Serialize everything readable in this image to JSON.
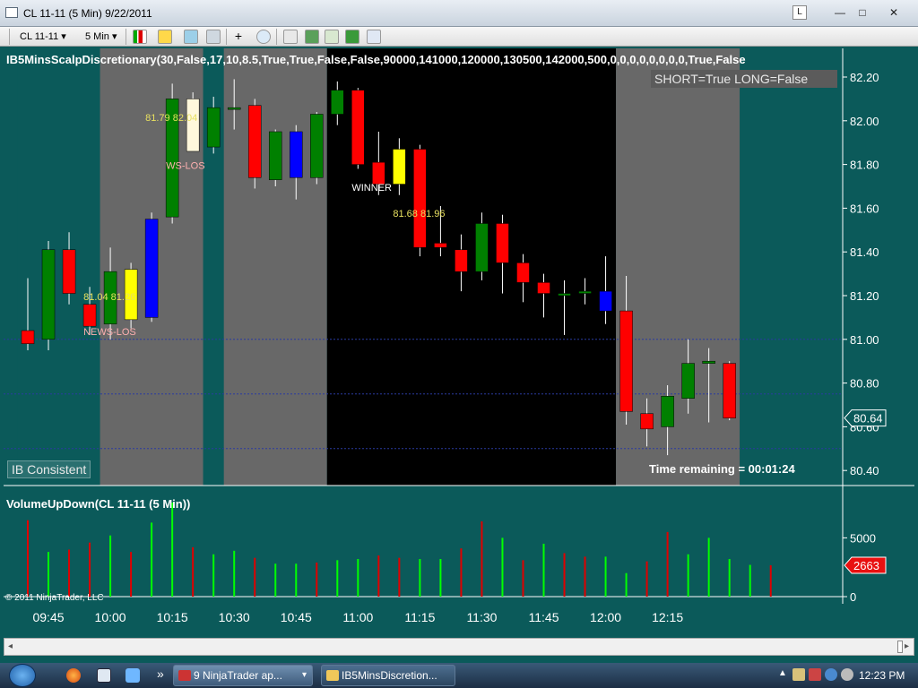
{
  "window": {
    "title": "CL 11-11 (5 Min)  9/22/2011",
    "link_label": "L",
    "minimize": "—",
    "maximize": "□",
    "close": "✕"
  },
  "toolbar": {
    "instrument": "CL 11-11",
    "interval": "5 Min",
    "dropdown_glyph": "▾"
  },
  "colors": {
    "background": "#0b5a5a",
    "up_candle": "#008000",
    "down_candle": "#ff0000",
    "highlight_yellow": "#ffff00",
    "highlight_blue": "#0000ff",
    "highlight_cream": "#fff8dc",
    "session_gray": "#686868",
    "session_black": "#000000",
    "volume_up": "#00ff00",
    "volume_down": "#e00000"
  },
  "chart_data": [
    {
      "type": "candlestick",
      "title": "IB5MinsScalpDiscretionary(30,False,17,10,8.5,True,True,False,False,90000,141000,120000,130500,142000,500,0,0,0,0,0,0,0,0,True,False",
      "y_ticks": [
        "82.20",
        "82.00",
        "81.80",
        "81.60",
        "81.40",
        "81.20",
        "81.00",
        "80.80",
        "80.60",
        "80.40"
      ],
      "ylim": [
        80.36,
        82.27
      ],
      "x_ticks": [
        "09:45",
        "10:00",
        "10:15",
        "10:30",
        "10:45",
        "11:00",
        "11:15",
        "11:30",
        "11:45",
        "12:00",
        "12:15"
      ],
      "last_price": "80.64",
      "status_text": "SHORT=True LONG=False",
      "time_remaining": "Time remaining = 00:01:24",
      "corner_label": "IB Consistent",
      "horizontal_lines": [
        81.0,
        80.75,
        80.5
      ],
      "trade_labels": [
        {
          "text": "81.04  81.26",
          "bar": 4,
          "price": 81.18
        },
        {
          "text": "NEWS-LOS",
          "bar": 4,
          "price": 81.02
        },
        {
          "text": "81.79  82.04",
          "bar": 7,
          "price": 82.0
        },
        {
          "text": "WS-LOS",
          "bar": 8,
          "price": 81.78
        },
        {
          "text": "WINNER",
          "bar": 17,
          "price": 81.68
        },
        {
          "text": "81.68  81.96",
          "bar": 19,
          "price": 81.56
        }
      ],
      "sessions": [
        {
          "from": -0.5,
          "to": 3.5,
          "color": "bg"
        },
        {
          "from": 3.5,
          "to": 8.5,
          "color": "gray"
        },
        {
          "from": 8.5,
          "to": 9.5,
          "color": "bg"
        },
        {
          "from": 9.5,
          "to": 14.5,
          "color": "gray"
        },
        {
          "from": 14.5,
          "to": 28.5,
          "color": "black"
        },
        {
          "from": 28.5,
          "to": 34.5,
          "color": "gray"
        },
        {
          "from": 34.5,
          "to": 39.5,
          "color": "bg"
        }
      ],
      "bars": [
        {
          "t": "09:40",
          "o": 81.04,
          "h": 81.28,
          "l": 80.95,
          "c": 80.98,
          "color": "red"
        },
        {
          "t": "09:45",
          "o": 81.0,
          "h": 81.45,
          "l": 80.95,
          "c": 81.41,
          "color": "green"
        },
        {
          "t": "09:50",
          "o": 81.41,
          "h": 81.49,
          "l": 81.16,
          "c": 81.21,
          "color": "red"
        },
        {
          "t": "09:55",
          "o": 81.16,
          "h": 81.24,
          "l": 81.02,
          "c": 81.06,
          "color": "red"
        },
        {
          "t": "10:00",
          "o": 81.07,
          "h": 81.42,
          "l": 81.0,
          "c": 81.31,
          "color": "green"
        },
        {
          "t": "10:05",
          "o": 81.32,
          "h": 81.35,
          "l": 81.05,
          "c": 81.09,
          "color": "yellow"
        },
        {
          "t": "10:10",
          "o": 81.1,
          "h": 81.58,
          "l": 81.08,
          "c": 81.55,
          "color": "blue"
        },
        {
          "t": "10:15",
          "o": 81.56,
          "h": 82.17,
          "l": 81.53,
          "c": 82.1,
          "color": "green"
        },
        {
          "t": "10:20",
          "o": 82.1,
          "h": 82.13,
          "l": 81.87,
          "c": 81.86,
          "color": "cream"
        },
        {
          "t": "10:25",
          "o": 81.88,
          "h": 82.11,
          "l": 81.85,
          "c": 82.06,
          "color": "green"
        },
        {
          "t": "10:30",
          "o": 82.06,
          "h": 82.19,
          "l": 81.96,
          "c": 82.06,
          "color": "green"
        },
        {
          "t": "10:35",
          "o": 82.07,
          "h": 82.1,
          "l": 81.69,
          "c": 81.74,
          "color": "red"
        },
        {
          "t": "10:40",
          "o": 81.73,
          "h": 81.96,
          "l": 81.7,
          "c": 81.95,
          "color": "green"
        },
        {
          "t": "10:45",
          "o": 81.95,
          "h": 81.98,
          "l": 81.64,
          "c": 81.74,
          "color": "blue"
        },
        {
          "t": "10:50",
          "o": 81.74,
          "h": 82.04,
          "l": 81.71,
          "c": 82.03,
          "color": "green"
        },
        {
          "t": "10:55",
          "o": 82.03,
          "h": 82.18,
          "l": 81.98,
          "c": 82.14,
          "color": "green"
        },
        {
          "t": "11:00",
          "o": 82.14,
          "h": 82.15,
          "l": 81.78,
          "c": 81.8,
          "color": "red"
        },
        {
          "t": "11:05",
          "o": 81.81,
          "h": 81.95,
          "l": 81.66,
          "c": 81.71,
          "color": "red"
        },
        {
          "t": "11:10",
          "o": 81.71,
          "h": 81.92,
          "l": 81.66,
          "c": 81.87,
          "color": "yellow"
        },
        {
          "t": "11:15",
          "o": 81.87,
          "h": 81.89,
          "l": 81.38,
          "c": 81.42,
          "color": "red"
        },
        {
          "t": "11:20",
          "o": 81.44,
          "h": 81.61,
          "l": 81.38,
          "c": 81.42,
          "color": "red"
        },
        {
          "t": "11:25",
          "o": 81.41,
          "h": 81.48,
          "l": 81.22,
          "c": 81.31,
          "color": "red"
        },
        {
          "t": "11:30",
          "o": 81.31,
          "h": 81.58,
          "l": 81.27,
          "c": 81.53,
          "color": "green"
        },
        {
          "t": "11:35",
          "o": 81.53,
          "h": 81.57,
          "l": 81.21,
          "c": 81.35,
          "color": "red"
        },
        {
          "t": "11:40",
          "o": 81.35,
          "h": 81.39,
          "l": 81.17,
          "c": 81.26,
          "color": "red"
        },
        {
          "t": "11:45",
          "o": 81.26,
          "h": 81.3,
          "l": 81.1,
          "c": 81.21,
          "color": "red"
        },
        {
          "t": "11:50",
          "o": 81.21,
          "h": 81.27,
          "l": 81.02,
          "c": 81.2,
          "color": "green"
        },
        {
          "t": "11:55",
          "o": 81.21,
          "h": 81.28,
          "l": 81.16,
          "c": 81.22,
          "color": "green"
        },
        {
          "t": "12:00",
          "o": 81.22,
          "h": 81.38,
          "l": 81.07,
          "c": 81.13,
          "color": "blue"
        },
        {
          "t": "12:05",
          "o": 81.13,
          "h": 81.29,
          "l": 80.61,
          "c": 80.67,
          "color": "red"
        },
        {
          "t": "12:10",
          "o": 80.66,
          "h": 80.73,
          "l": 80.51,
          "c": 80.59,
          "color": "red"
        },
        {
          "t": "12:15",
          "o": 80.6,
          "h": 80.79,
          "l": 80.47,
          "c": 80.74,
          "color": "green"
        },
        {
          "t": "12:20",
          "o": 80.73,
          "h": 81.0,
          "l": 80.66,
          "c": 80.89,
          "color": "green"
        },
        {
          "t": "12:25",
          "o": 80.89,
          "h": 80.96,
          "l": 80.62,
          "c": 80.9,
          "color": "green"
        },
        {
          "t": "12:30",
          "o": 80.89,
          "h": 80.9,
          "l": 80.63,
          "c": 80.64,
          "color": "red"
        }
      ]
    },
    {
      "type": "bar",
      "title": "VolumeUpDown(CL 11-11 (5 Min))",
      "y_ticks": [
        "5000",
        "0"
      ],
      "ylim": [
        0,
        8000
      ],
      "last_value": "2663",
      "copyright": "© 2011 NinjaTrader, LLC",
      "values": [
        6500,
        3800,
        4000,
        4600,
        5200,
        3800,
        6300,
        8000,
        4200,
        3600,
        3900,
        3300,
        2800,
        2800,
        2900,
        3100,
        3200,
        3500,
        3300,
        3200,
        3200,
        4100,
        6400,
        5000,
        3100,
        4500,
        3700,
        3400,
        3400,
        2000,
        3000,
        5500,
        3600,
        5000,
        3200,
        2700,
        2663
      ],
      "colors": [
        "red",
        "green",
        "red",
        "red",
        "green",
        "red",
        "green",
        "green",
        "red",
        "green",
        "green",
        "red",
        "green",
        "green",
        "red",
        "green",
        "green",
        "red",
        "red",
        "green",
        "green",
        "red",
        "red",
        "green",
        "red",
        "green",
        "red",
        "red",
        "green",
        "green",
        "red",
        "red",
        "green",
        "green",
        "green",
        "green",
        "red"
      ]
    }
  ],
  "taskbar": {
    "tasks": [
      {
        "label": "9 NinjaTrader ap...",
        "icon": "ninjatrader-icon"
      },
      {
        "label": "IB5MinsDiscretion...",
        "icon": "folder-icon"
      }
    ],
    "clock": "12:23 PM",
    "chevron": "»",
    "tray_arrow": "▲"
  }
}
